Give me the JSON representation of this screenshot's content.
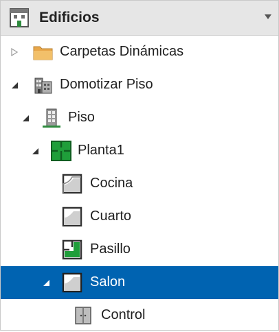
{
  "header": {
    "title": "Edificios",
    "icon": "building-window-icon",
    "dropdown_icon": "dropdown-arrow-icon"
  },
  "tree": [
    {
      "label": "Carpetas Dinámicas",
      "icon": "folder-icon",
      "expander": "collapsed",
      "selected": false
    },
    {
      "label": "Domotizar Piso",
      "icon": "buildings-icon",
      "expander": "expanded",
      "selected": false
    },
    {
      "label": "Piso",
      "icon": "building-floor-icon",
      "expander": "expanded",
      "selected": false
    },
    {
      "label": "Planta1",
      "icon": "floorplan-icon",
      "expander": "expanded",
      "selected": false
    },
    {
      "label": "Cocina",
      "icon": "room-icon",
      "expander": "none",
      "selected": false
    },
    {
      "label": "Cuarto",
      "icon": "room-icon",
      "expander": "none",
      "selected": false
    },
    {
      "label": "Pasillo",
      "icon": "hallway-icon",
      "expander": "none",
      "selected": false
    },
    {
      "label": "Salon",
      "icon": "room-icon",
      "expander": "expanded",
      "selected": true
    },
    {
      "label": "Control",
      "icon": "control-panel-icon",
      "expander": "none",
      "selected": false
    }
  ],
  "colors": {
    "selection": "#0063b1",
    "floorplan_green": "#1f9e3a",
    "folder": "#e8a74a",
    "header_bg": "#e6e6e6"
  }
}
